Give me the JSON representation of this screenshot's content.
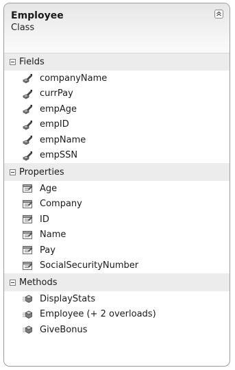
{
  "class_box": {
    "title": "Employee",
    "subtitle": "Class"
  },
  "sections": [
    {
      "label": "Fields",
      "icon": "field-icon",
      "items": [
        "companyName",
        "currPay",
        "empAge",
        "empID",
        "empName",
        "empSSN"
      ]
    },
    {
      "label": "Properties",
      "icon": "property-icon",
      "items": [
        "Age",
        "Company",
        "ID",
        "Name",
        "Pay",
        "SocialSecurityNumber"
      ]
    },
    {
      "label": "Methods",
      "icon": "method-icon",
      "items": [
        "DisplayStats",
        "Employee (+ 2 overloads)",
        "GiveBonus"
      ]
    }
  ]
}
